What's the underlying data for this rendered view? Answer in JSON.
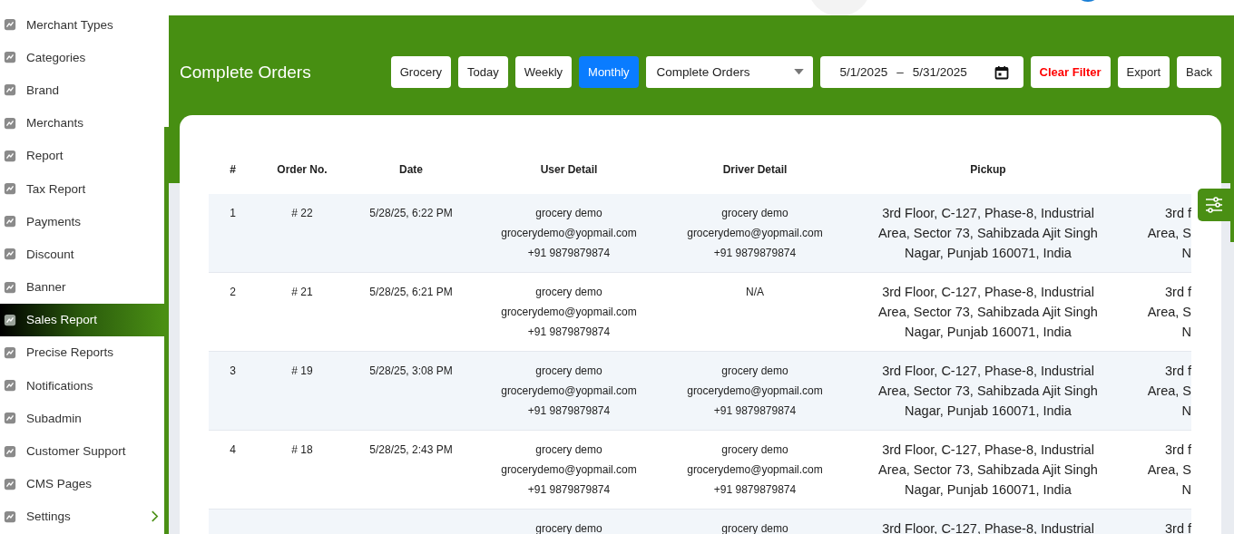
{
  "sidebar": {
    "items": [
      {
        "label": "Merchant Types",
        "selected": false,
        "expandable": false
      },
      {
        "label": "Categories",
        "selected": false,
        "expandable": false
      },
      {
        "label": "Brand",
        "selected": false,
        "expandable": false
      },
      {
        "label": "Merchants",
        "selected": false,
        "expandable": false
      },
      {
        "label": "Report",
        "selected": false,
        "expandable": false
      },
      {
        "label": "Tax Report",
        "selected": false,
        "expandable": false
      },
      {
        "label": "Payments",
        "selected": false,
        "expandable": false
      },
      {
        "label": "Discount",
        "selected": false,
        "expandable": false
      },
      {
        "label": "Banner",
        "selected": false,
        "expandable": false
      },
      {
        "label": "Sales Report",
        "selected": true,
        "expandable": false
      },
      {
        "label": "Precise Reports",
        "selected": false,
        "expandable": false
      },
      {
        "label": "Notifications",
        "selected": false,
        "expandable": false
      },
      {
        "label": "Subadmin",
        "selected": false,
        "expandable": false
      },
      {
        "label": "Customer Support",
        "selected": false,
        "expandable": false
      },
      {
        "label": "CMS Pages",
        "selected": false,
        "expandable": false
      },
      {
        "label": "Settings",
        "selected": false,
        "expandable": true
      }
    ]
  },
  "page_title": "Complete Orders",
  "filters": [
    {
      "label": "Grocery",
      "selected": false
    },
    {
      "label": "Today",
      "selected": false
    },
    {
      "label": "Weekly",
      "selected": false
    },
    {
      "label": "Monthly",
      "selected": true
    }
  ],
  "status_select": {
    "value": "Complete Orders"
  },
  "date_range": {
    "start": "5/1/2025",
    "separator": "–",
    "end": "5/31/2025"
  },
  "actions": [
    {
      "label": "Clear Filter",
      "kind": "danger"
    },
    {
      "label": "Export",
      "kind": "default"
    },
    {
      "label": "Back",
      "kind": "default"
    }
  ],
  "table": {
    "columns": [
      "#",
      "Order No.",
      "Date",
      "User Detail",
      "Driver Detail",
      "Pickup"
    ],
    "rows": [
      {
        "num": "1",
        "order": "# 22",
        "date": "5/28/25, 6:22 PM",
        "user": [
          "grocery demo",
          "grocerydemo@yopmail.com",
          "+91 9879879874"
        ],
        "driver": [
          "grocery demo",
          "grocerydemo@yopmail.com",
          "+91 9879879874"
        ],
        "pickup": [
          "3rd Floor, C-127, Phase-8, Industrial",
          "Area, Sector 73, Sahibzada Ajit Singh",
          "Nagar, Punjab 160071, India"
        ],
        "column_7": [
          "3rd f",
          "Area, S",
          "N"
        ]
      },
      {
        "num": "2",
        "order": "# 21",
        "date": "5/28/25, 6:21 PM",
        "user": [
          "grocery demo",
          "grocerydemo@yopmail.com",
          "+91 9879879874"
        ],
        "driver": [
          "N/A"
        ],
        "pickup": [
          "3rd Floor, C-127, Phase-8, Industrial",
          "Area, Sector 73, Sahibzada Ajit Singh",
          "Nagar, Punjab 160071, India"
        ],
        "column_7": [
          "3rd f",
          "Area, S",
          "N"
        ]
      },
      {
        "num": "3",
        "order": "# 19",
        "date": "5/28/25, 3:08 PM",
        "user": [
          "grocery demo",
          "grocerydemo@yopmail.com",
          "+91 9879879874"
        ],
        "driver": [
          "grocery demo",
          "grocerydemo@yopmail.com",
          "+91 9879879874"
        ],
        "pickup": [
          "3rd Floor, C-127, Phase-8, Industrial",
          "Area, Sector 73, Sahibzada Ajit Singh",
          "Nagar, Punjab 160071, India"
        ],
        "column_7": [
          "3rd f",
          "Area, S",
          "N"
        ]
      },
      {
        "num": "4",
        "order": "# 18",
        "date": "5/28/25, 2:43 PM",
        "user": [
          "grocery demo",
          "grocerydemo@yopmail.com",
          "+91 9879879874"
        ],
        "driver": [
          "grocery demo",
          "grocerydemo@yopmail.com",
          "+91 9879879874"
        ],
        "pickup": [
          "3rd Floor, C-127, Phase-8, Industrial",
          "Area, Sector 73, Sahibzada Ajit Singh",
          "Nagar, Punjab 160071, India"
        ],
        "column_7": [
          "3rd f",
          "Area, S",
          "N"
        ]
      },
      {
        "user": [
          "grocery demo"
        ],
        "driver": [
          "grocery demo"
        ],
        "pickup": [
          "3rd Floor, C-127, Phase-8, Industrial"
        ],
        "column_7": [
          "3rd f"
        ]
      }
    ]
  }
}
